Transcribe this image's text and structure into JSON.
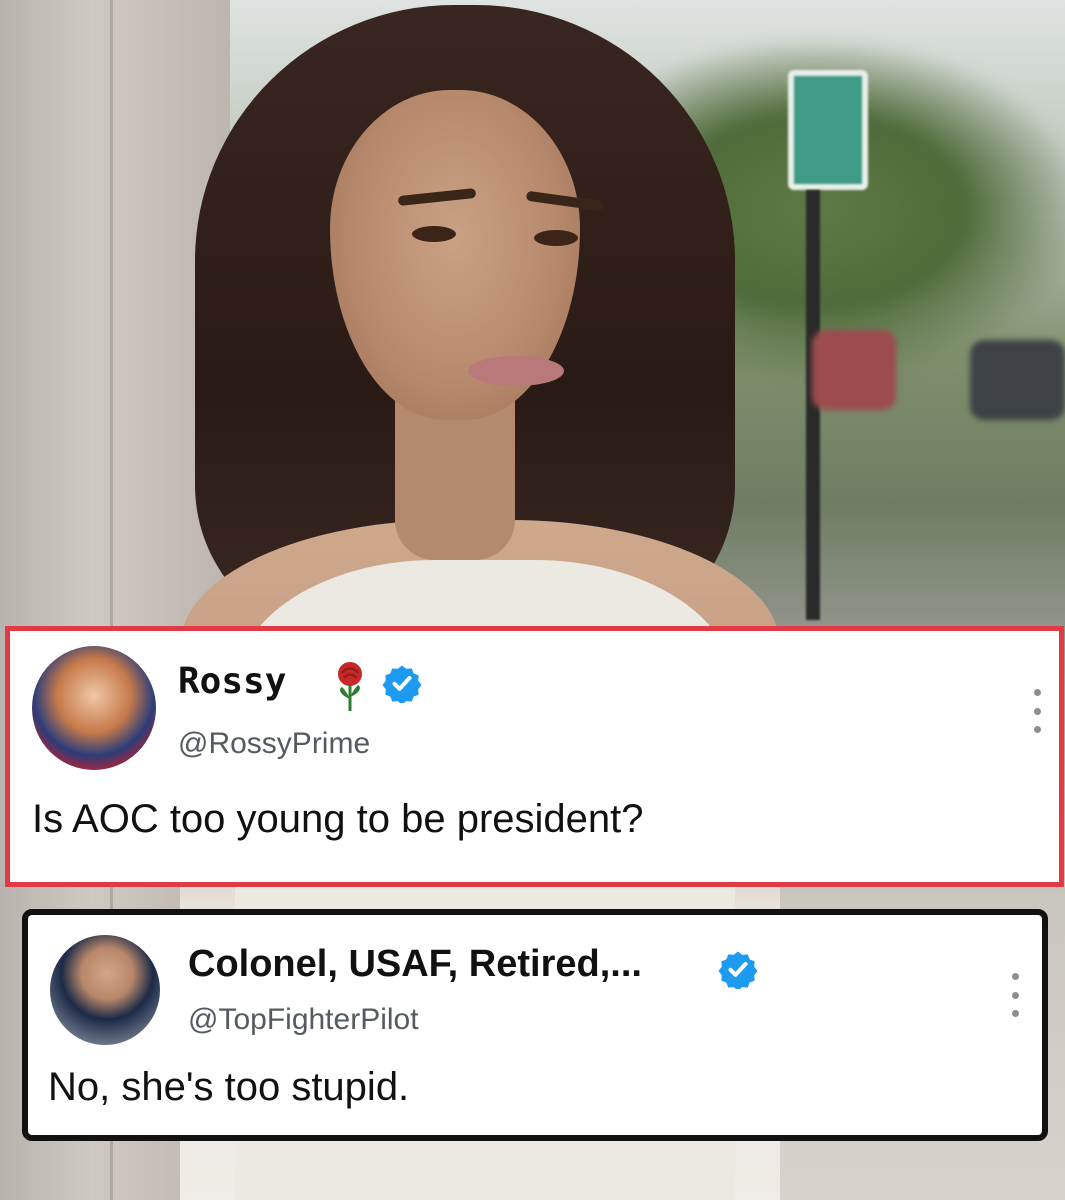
{
  "tweets": [
    {
      "display_name": "Rossy",
      "handle": "@RossyPrime",
      "text": "Is AOC too young to be president?",
      "verified": true,
      "emoji": "rose-icon",
      "border_color": "#e23a44"
    },
    {
      "display_name": "Colonel, USAF, Retired,...",
      "handle": "@TopFighterPilot",
      "text": "No, she's too stupid.",
      "verified": true,
      "border_color": "#111111"
    }
  ],
  "colors": {
    "verified_badge": "#1d9bf0"
  }
}
